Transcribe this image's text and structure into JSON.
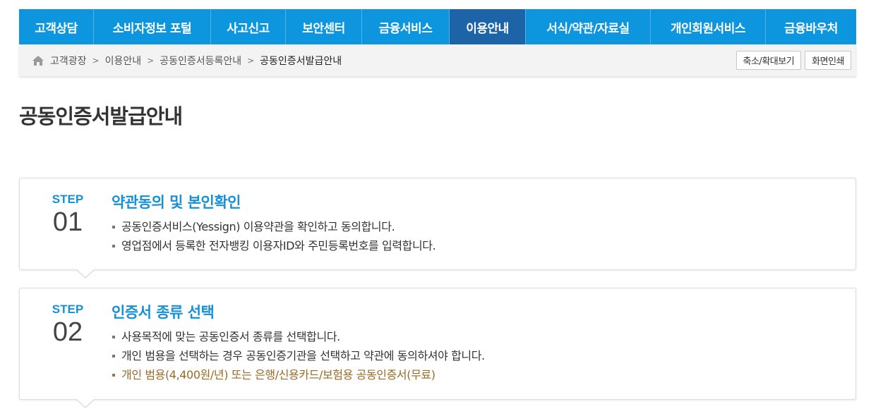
{
  "nav": {
    "items": [
      {
        "label": "고객상담",
        "active": false
      },
      {
        "label": "소비자정보 포털",
        "active": false
      },
      {
        "label": "사고신고",
        "active": false
      },
      {
        "label": "보안센터",
        "active": false
      },
      {
        "label": "금융서비스",
        "active": false
      },
      {
        "label": "이용안내",
        "active": true
      },
      {
        "label": "서식/약관/자료실",
        "active": false
      },
      {
        "label": "개인회원서비스",
        "active": false
      },
      {
        "label": "금융바우처",
        "active": false
      }
    ],
    "bg_color": "#0d95dd",
    "active_color": "#1d63a8"
  },
  "breadcrumb": {
    "home_icon": "home-icon",
    "items": [
      "고객광장",
      "이용안내",
      "공동인증서등록안내",
      "공동인증서발급안내"
    ],
    "tools": {
      "zoom_label": "축소/확대보기",
      "print_label": "화면인쇄"
    }
  },
  "page": {
    "title": "공동인증서발급안내"
  },
  "steps": [
    {
      "step_word": "STEP",
      "number": "01",
      "heading": "약관동의 및 본인확인",
      "lines": [
        "공동인증서비스(Yessign) 이용약관을 확인하고 동의합니다.",
        "영업점에서 등록한 전자뱅킹 이용자ID와 주민등록번호를 입력합니다."
      ]
    },
    {
      "step_word": "STEP",
      "number": "02",
      "heading": "인증서 종류 선택",
      "lines": [
        "사용목적에 맞는 공동인증서 종류를 선택합니다.",
        "개인 범용을 선택하는 경우 공동인증기관을 선택하고 약관에 동의하셔야 합니다."
      ],
      "note": "개인 범용(4,400원/년) 또는 은행/신용카드/보험용 공동인증서(무료)"
    }
  ],
  "colors": {
    "accent": "#1790d6",
    "note": "#9a6a24"
  }
}
